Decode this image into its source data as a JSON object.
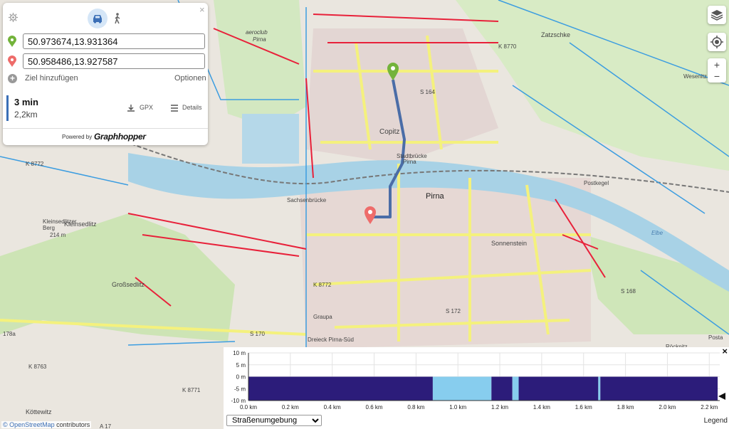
{
  "colors": {
    "route": "#4a6da7",
    "start": "#73b33b",
    "end": "#ee6c6a",
    "road_yellow": "#f4f17d",
    "bike_red": "#e8213a",
    "river": "#a8d2e6",
    "elevation_dark": "#2c1c7a",
    "elevation_light": "#87cdee"
  },
  "panel": {
    "modes": [
      {
        "icon": "car-icon",
        "active": true
      },
      {
        "icon": "walk-icon",
        "active": false
      }
    ],
    "start_value": "50.973674,13.931364",
    "end_value": "50.958486,13.927587",
    "add_destination": "Ziel hinzufügen",
    "options": "Optionen",
    "route": {
      "time": "3 min",
      "distance": "2,2km"
    },
    "gpx": "GPX",
    "details": "Details",
    "powered_by": "Powered by",
    "brand": "Graphhopper"
  },
  "map_labels": [
    "aeroclub",
    "Pirna",
    "Zatzschke",
    "K 8770",
    "Copitz",
    "S 164",
    "Stadtbrücke",
    "Pirna",
    "Sachsenbrücke",
    "Pirna",
    "K 8772",
    "Kleinsedlitz",
    "Kleinsedlitzer",
    "Berg",
    "214 m",
    "Sonnenstein",
    "K 8772",
    "S 172",
    "S 168",
    "K 8763",
    "K 8771",
    "Großsedlitz",
    "Köttewitz",
    "Postkegel",
    "Elbe",
    "178a",
    "A 17",
    "S 170",
    "Dreieck Pirna-Süd",
    "Graupa",
    "Posta",
    "Röcknitz",
    "Wesenitz"
  ],
  "elevation": {
    "y_ticks": [
      "10 m",
      "5 m",
      "0 m",
      "-5 m",
      "-10 m"
    ],
    "x_ticks": [
      "0.0 km",
      "0.2 km",
      "0.4 km",
      "0.6 km",
      "0.8 km",
      "1.0 km",
      "1.2 km",
      "1.4 km",
      "1.6 km",
      "1.8 km",
      "2.0 km",
      "2.2 km"
    ],
    "select_value": "Straßenumgebung",
    "legend": "Legend",
    "close": "×"
  },
  "chart_data": {
    "type": "area",
    "title": "",
    "xlabel": "",
    "ylabel": "",
    "xlim": [
      0,
      2.25
    ],
    "ylim": [
      -10,
      10
    ],
    "segments": [
      {
        "from": 0.0,
        "to": 0.88,
        "elevation": 0,
        "category": "dark"
      },
      {
        "from": 0.88,
        "to": 1.16,
        "elevation": 0,
        "category": "light"
      },
      {
        "from": 1.16,
        "to": 1.26,
        "elevation": 0,
        "category": "dark"
      },
      {
        "from": 1.26,
        "to": 1.29,
        "elevation": 0,
        "category": "light"
      },
      {
        "from": 1.29,
        "to": 1.67,
        "elevation": 0,
        "category": "dark"
      },
      {
        "from": 1.67,
        "to": 1.68,
        "elevation": 0,
        "category": "light"
      },
      {
        "from": 1.68,
        "to": 2.24,
        "elevation": 0,
        "category": "dark"
      }
    ],
    "baseline": -10
  },
  "attribution": {
    "osm": "© OpenStreetMap",
    "contributors": " contributors"
  }
}
